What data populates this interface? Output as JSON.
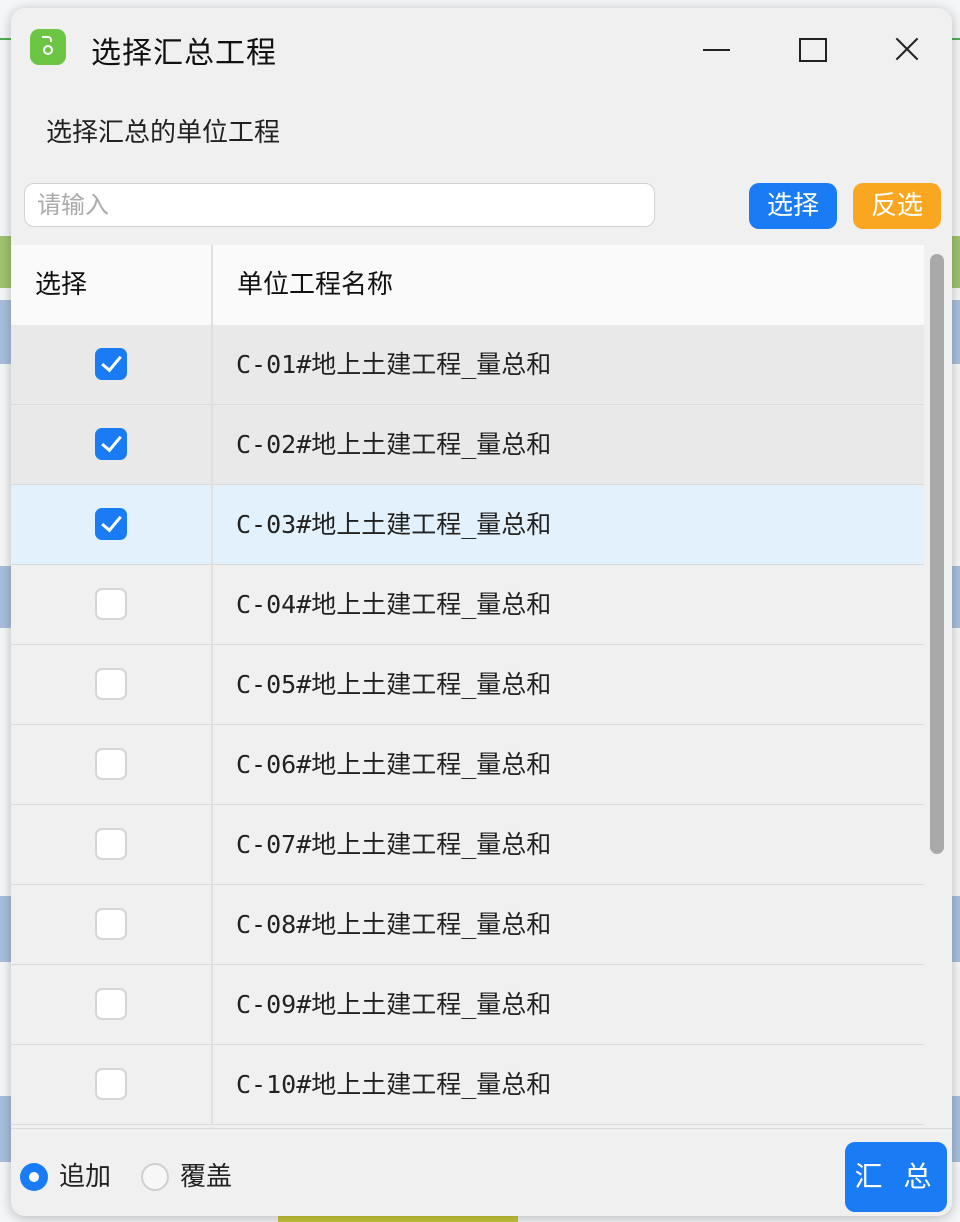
{
  "dialog": {
    "title": "选择汇总工程",
    "subtitle": "选择汇总的单位工程"
  },
  "search": {
    "placeholder": "请输入",
    "value": ""
  },
  "buttons": {
    "select": "选择",
    "invert": "反选",
    "summary": "汇 总"
  },
  "table": {
    "columns": [
      "选择",
      "单位工程名称"
    ],
    "rows": [
      {
        "name": "C-01#地上土建工程_量总和",
        "checked": true
      },
      {
        "name": "C-02#地上土建工程_量总和",
        "checked": true
      },
      {
        "name": "C-03#地上土建工程_量总和",
        "checked": true
      },
      {
        "name": "C-04#地上土建工程_量总和",
        "checked": false
      },
      {
        "name": "C-05#地上土建工程_量总和",
        "checked": false
      },
      {
        "name": "C-06#地上土建工程_量总和",
        "checked": false
      },
      {
        "name": "C-07#地上土建工程_量总和",
        "checked": false
      },
      {
        "name": "C-08#地上土建工程_量总和",
        "checked": false
      },
      {
        "name": "C-09#地上土建工程_量总和",
        "checked": false
      },
      {
        "name": "C-10#地上土建工程_量总和",
        "checked": false
      }
    ]
  },
  "mode": {
    "options": [
      "追加",
      "覆盖"
    ],
    "selected": "追加"
  },
  "colors": {
    "accent": "#1a7cf5",
    "invert_button": "#f9a720",
    "app_icon": "#6cc644",
    "row_highlight": "#e3f1fc"
  },
  "icons": {
    "app": "app-logo-icon",
    "minimize": "minimize-icon",
    "maximize": "maximize-icon",
    "close": "close-icon"
  }
}
